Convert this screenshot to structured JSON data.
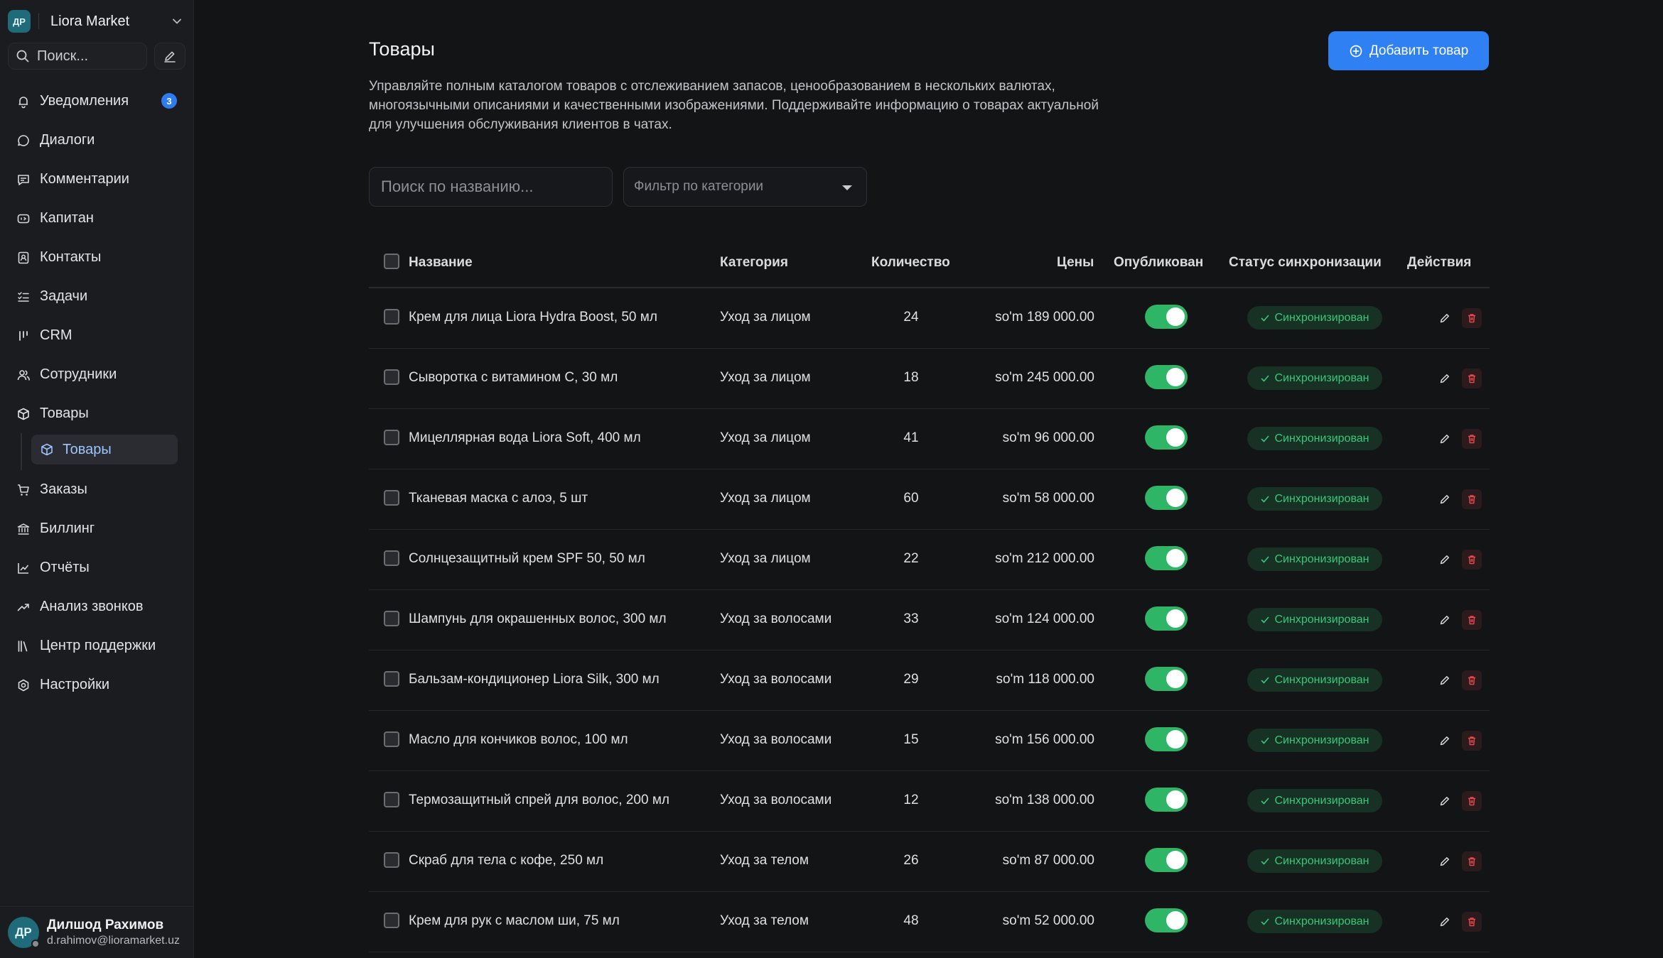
{
  "workspace": {
    "avatar": "ДР",
    "name": "Liora Market"
  },
  "sidebar": {
    "search_placeholder": "Поиск...",
    "items": [
      {
        "label": "Уведомления",
        "icon": "bell-icon",
        "badge": "3"
      },
      {
        "label": "Диалоги",
        "icon": "chat-icon"
      },
      {
        "label": "Комментарии",
        "icon": "comment-icon"
      },
      {
        "label": "Капитан",
        "icon": "captain-icon"
      },
      {
        "label": "Контакты",
        "icon": "contacts-icon"
      },
      {
        "label": "Задачи",
        "icon": "tasks-icon"
      },
      {
        "label": "CRM",
        "icon": "crm-icon"
      },
      {
        "label": "Сотрудники",
        "icon": "users-icon"
      },
      {
        "label": "Товары",
        "icon": "box-icon"
      }
    ],
    "sub_item": {
      "label": "Товары",
      "icon": "box-icon"
    },
    "items_after": [
      {
        "label": "Заказы",
        "icon": "cart-icon"
      },
      {
        "label": "Биллинг",
        "icon": "billing-icon"
      },
      {
        "label": "Отчёты",
        "icon": "reports-icon"
      },
      {
        "label": "Анализ звонков",
        "icon": "trend-icon"
      },
      {
        "label": "Центр поддержки",
        "icon": "library-icon"
      },
      {
        "label": "Настройки",
        "icon": "settings-icon"
      }
    ]
  },
  "user": {
    "avatar": "ДР",
    "name": "Дилшод Рахимов",
    "email": "d.rahimov@lioramarket.uz"
  },
  "page": {
    "title": "Товары",
    "add_button": "Добавить товар",
    "description": "Управляйте полным каталогом товаров с отслеживанием запасов, ценообразованием в нескольких валютах, многоязычными описаниями и качественными изображениями. Поддерживайте информацию о товарах актуальной для улучшения обслуживания клиентов в чатах.",
    "search_placeholder": "Поиск по названию...",
    "category_filter": "Фильтр по категории"
  },
  "table": {
    "headers": {
      "name": "Название",
      "category": "Категория",
      "quantity": "Количество",
      "prices": "Цены",
      "published": "Опубликован",
      "sync": "Статус синхронизации",
      "actions": "Действия"
    },
    "rows": [
      {
        "name": "Крем для лица Liora Hydra Boost, 50 мл",
        "category": "Уход за лицом",
        "quantity": "24",
        "price": "so'm 189 000.00",
        "published": true,
        "sync": "Синхронизирован"
      },
      {
        "name": "Сыворотка с витамином С, 30 мл",
        "category": "Уход за лицом",
        "quantity": "18",
        "price": "so'm 245 000.00",
        "published": true,
        "sync": "Синхронизирован"
      },
      {
        "name": "Мицеллярная вода Liora Soft, 400 мл",
        "category": "Уход за лицом",
        "quantity": "41",
        "price": "so'm 96 000.00",
        "published": true,
        "sync": "Синхронизирован"
      },
      {
        "name": "Тканевая маска с алоэ, 5 шт",
        "category": "Уход за лицом",
        "quantity": "60",
        "price": "so'm 58 000.00",
        "published": true,
        "sync": "Синхронизирован"
      },
      {
        "name": "Солнцезащитный крем SPF 50, 50 мл",
        "category": "Уход за лицом",
        "quantity": "22",
        "price": "so'm 212 000.00",
        "published": true,
        "sync": "Синхронизирован"
      },
      {
        "name": "Шампунь для окрашенных волос, 300 мл",
        "category": "Уход за волосами",
        "quantity": "33",
        "price": "so'm 124 000.00",
        "published": true,
        "sync": "Синхронизирован"
      },
      {
        "name": "Бальзам-кондиционер Liora Silk, 300 мл",
        "category": "Уход за волосами",
        "quantity": "29",
        "price": "so'm 118 000.00",
        "published": true,
        "sync": "Синхронизирован"
      },
      {
        "name": "Масло для кончиков волос, 100 мл",
        "category": "Уход за волосами",
        "quantity": "15",
        "price": "so'm 156 000.00",
        "published": true,
        "sync": "Синхронизирован"
      },
      {
        "name": "Термозащитный спрей для волос, 200 мл",
        "category": "Уход за волосами",
        "quantity": "12",
        "price": "so'm 138 000.00",
        "published": true,
        "sync": "Синхронизирован"
      },
      {
        "name": "Скраб для тела с кофе, 250 мл",
        "category": "Уход за телом",
        "quantity": "26",
        "price": "so'm 87 000.00",
        "published": true,
        "sync": "Синхронизирован"
      },
      {
        "name": "Крем для рук с маслом ши, 75 мл",
        "category": "Уход за телом",
        "quantity": "48",
        "price": "so'm 52 000.00",
        "published": true,
        "sync": "Синхронизирован"
      }
    ]
  },
  "colors": {
    "accent": "#2f80f2",
    "toggle_on": "#2fb566",
    "sync_text": "#39c77a",
    "delete": "#e5484d",
    "badge": "#2f7bf0"
  }
}
